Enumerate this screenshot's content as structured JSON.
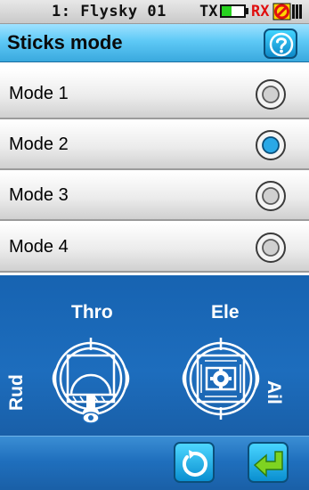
{
  "status_bar": {
    "model_name": "1: Flysky 01",
    "tx_label": "TX",
    "tx_battery_level": 0.45,
    "rx_label": "RX",
    "rx_signal_icon": "no-signal-icon"
  },
  "header": {
    "title": "Sticks mode",
    "help_icon": "help-icon"
  },
  "modes": [
    {
      "label": "Mode 1",
      "selected": false
    },
    {
      "label": "Mode 2",
      "selected": true
    },
    {
      "label": "Mode 3",
      "selected": false
    },
    {
      "label": "Mode 4",
      "selected": false
    }
  ],
  "sticks_panel": {
    "left_top_label": "Thro",
    "right_top_label": "Ele",
    "left_side_label": "Rud",
    "right_side_label": "Ail"
  },
  "bottom_bar": {
    "reset_icon": "reset-icon",
    "back_icon": "back-arrow-icon"
  },
  "colors": {
    "title_bar": "#5ec9f6",
    "panel_blue": "#1d6dbd",
    "radio_selected": "#2aa8e6",
    "battery_fill": "#27d21f",
    "rx_red": "#e01010"
  }
}
